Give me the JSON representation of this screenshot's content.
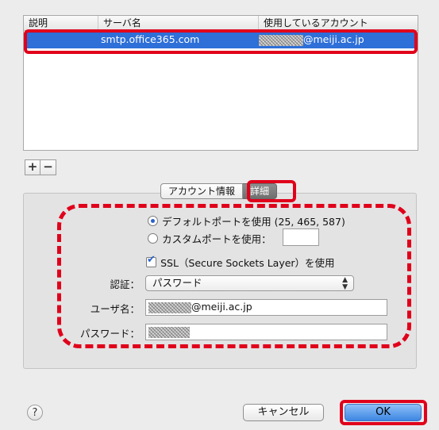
{
  "table": {
    "headers": [
      "説明",
      "サーバ名",
      "使用しているアカウント"
    ],
    "rows": [
      {
        "description": "",
        "server": "smtp.office365.com",
        "account": "@meiji.ac.jp"
      }
    ]
  },
  "buttons": {
    "add": "+",
    "remove": "−",
    "help": "?",
    "cancel": "キャンセル",
    "ok": "OK"
  },
  "tabs": [
    {
      "label": "アカウント情報",
      "active": false
    },
    {
      "label": "詳細",
      "active": true
    }
  ],
  "settings": {
    "default_port_label": "デフォルトポートを使用 (25, 465, 587)",
    "custom_port_label": "カスタムポートを使用：",
    "custom_port_value": "",
    "ssl_label": "SSL（Secure Sockets Layer）を使用",
    "ssl_checked": true,
    "auth_label": "認証：",
    "auth_value": "パスワード",
    "username_label": "ユーザ名：",
    "username_value": "@meiji.ac.jp",
    "password_label": "パスワード："
  },
  "colors": {
    "selection": "#2e6fd8",
    "annotation_red": "#e0001b"
  }
}
